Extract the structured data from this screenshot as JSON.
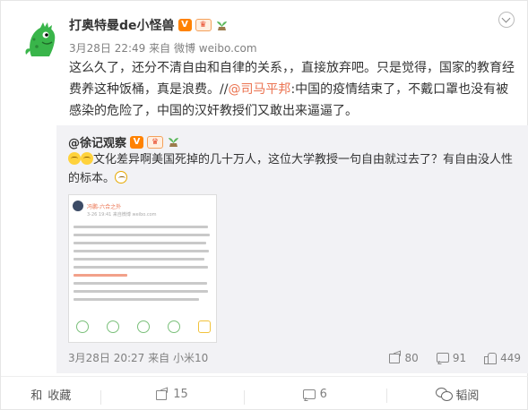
{
  "post": {
    "author": "打奥特曼de小怪兽",
    "time": "3月28日 22:49",
    "source_prefix": "来自",
    "source": "微博 weibo.com",
    "text_part1": "这么久了，还分不清自由和自律的关系，，直接放弃吧。只是觉得，国家的教育经费养这种饭桶，真是浪费。//",
    "mention": "@司马平邦",
    "text_part2": ":中国的疫情结束了，不戴口罩也没有被感染的危险了，中国的汉奸教授们又敢出来逼逼了。"
  },
  "repost": {
    "author": "@徐记观察",
    "text": "文化差异啊美国死掉的几十万人，这位大学教授一句自由就过去了？有自由没人性的标本。",
    "time": "3月28日 20:27",
    "source_prefix": "来自",
    "source": "小米10",
    "thumbnail": {
      "name": "冯鹏-六合之外",
      "meta": "3-26 19:41  来自微博  weibo.com"
    },
    "stats": {
      "reposts": "80",
      "comments": "91",
      "likes": "449"
    }
  },
  "actions": {
    "favorite": "收藏",
    "favorite_prefix": "和",
    "repost_count": "15",
    "comment_count": "6",
    "wechat_label": "韬阅"
  },
  "colors": {
    "mention": "#eb7350",
    "badge_orange": "#ff8200",
    "repost_bg": "#f2f2f5",
    "meta_text": "#808080"
  },
  "icons": [
    "chevron-down-icon",
    "verified-v-icon",
    "vip-icon",
    "plant-icon",
    "share-icon",
    "comment-icon",
    "like-icon",
    "wechat-icon"
  ]
}
